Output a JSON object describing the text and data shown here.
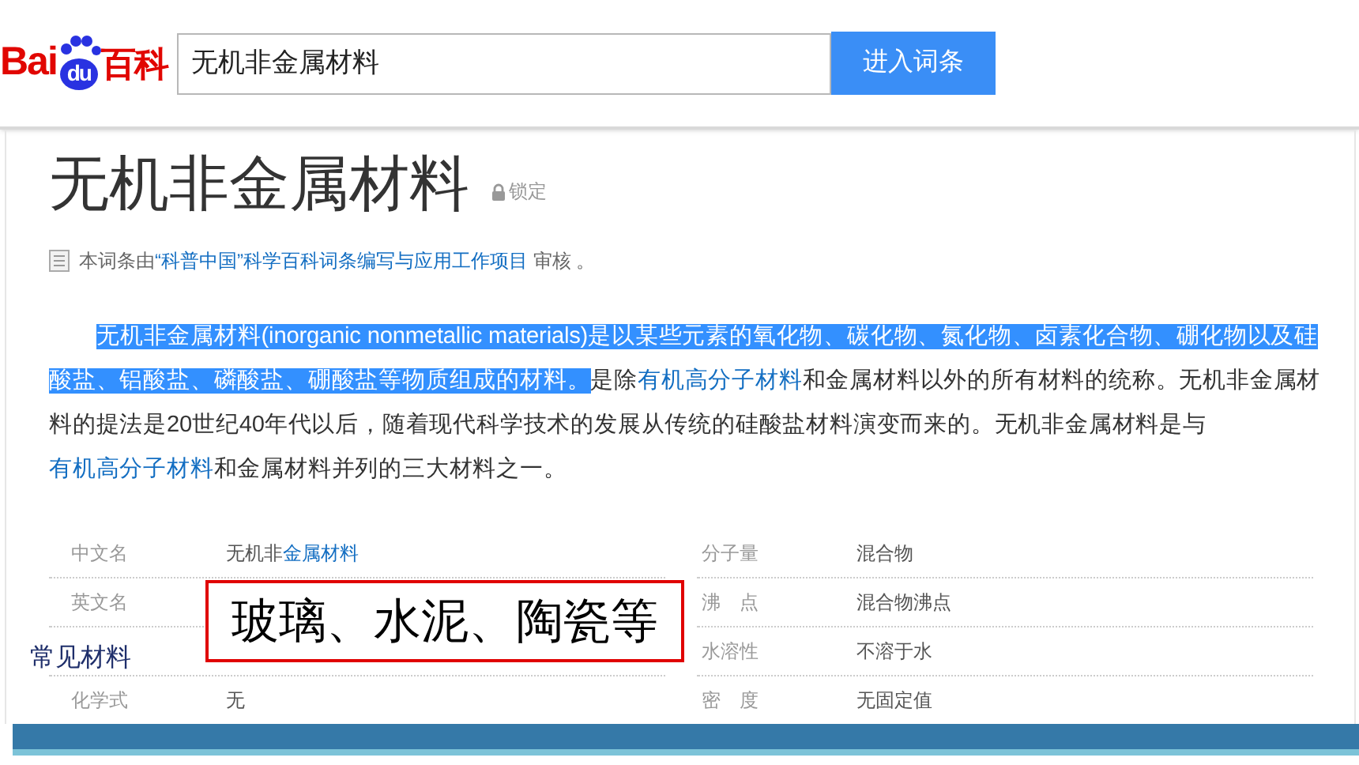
{
  "header": {
    "logo": {
      "latin": "Bai",
      "badge": "du",
      "cjk": "百科"
    },
    "search": {
      "value": "无机非金属材料"
    },
    "button": "进入词条"
  },
  "entry": {
    "title": "无机非金属材料",
    "lock": "锁定",
    "review_note": [
      {
        "text": "本词条由",
        "kind": "plain"
      },
      {
        "text": "“科普中国”科学百科词条编写与应用工作项目",
        "kind": "link"
      },
      {
        "text": " 审核 。",
        "kind": "plain"
      }
    ],
    "paragraph": [
      {
        "text": "无机非金属材料(inorganic nonmetallic materials)是以某些元素的氧化物、碳化物、氮化物、卤素化合物、硼化物以及硅酸盐、铝酸盐、磷酸盐、硼酸盐等物质组成的材料。",
        "kind": "highlight"
      },
      {
        "text": "是除",
        "kind": "plain"
      },
      {
        "text": "有机高分子材料",
        "kind": "link"
      },
      {
        "text": "和金属材料以外的所有材料的统称。无机非金属材料的提法是20世纪40年代以后，随着现代科学技术的发展从传统的硅酸盐材料演变而来的。无机非金属材料是与",
        "kind": "plain"
      },
      {
        "text": "有机高分子材料",
        "kind": "link"
      },
      {
        "text": "和金属材料并列的三大材料之一。",
        "kind": "plain"
      }
    ],
    "info_left": [
      {
        "label": "中文名",
        "value": [
          {
            "text": "无机非",
            "kind": "plain"
          },
          {
            "text": "金属材料",
            "kind": "link"
          }
        ]
      },
      {
        "label": "英文名"
      },
      {
        "label": "常见材料",
        "kind": "annotation"
      },
      {
        "label": "化学式",
        "value": [
          {
            "text": "无",
            "kind": "plain"
          }
        ]
      }
    ],
    "info_right": [
      {
        "label": "分子量",
        "value": "混合物"
      },
      {
        "label": "沸　点",
        "value": "混合物沸点"
      },
      {
        "label": "水溶性",
        "value": "不溶于水"
      },
      {
        "label": "密　度",
        "value": "无固定值"
      }
    ]
  },
  "overlay": {
    "callout": "玻璃、水泥、陶瓷等"
  }
}
